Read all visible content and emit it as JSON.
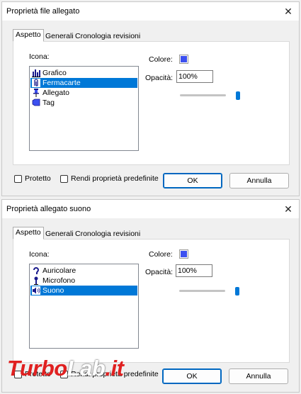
{
  "dialog1": {
    "title": "Proprietà file allegato",
    "close_glyph": "✕",
    "tabs": [
      "Aspetto",
      "Generali",
      "Cronologia revisioni"
    ],
    "icon_label": "Icona:",
    "items": [
      {
        "label": "Grafico",
        "icon": "bar-chart-icon",
        "selected": false
      },
      {
        "label": "Fermacarte",
        "icon": "paperclip-icon",
        "selected": true
      },
      {
        "label": "Allegato",
        "icon": "pushpin-icon",
        "selected": false
      },
      {
        "label": "Tag",
        "icon": "tag-icon",
        "selected": false
      }
    ],
    "color_label": "Colore:",
    "color_value": "#3c50f0",
    "opacity_label": "Opacità:",
    "opacity_value": "100%",
    "opacity_fraction": 1.0,
    "locked_label": "Protetto",
    "default_label": "Rendi proprietà predefinite",
    "ok_label": "OK",
    "cancel_label": "Annulla"
  },
  "dialog2": {
    "title": "Proprietà allegato suono",
    "close_glyph": "✕",
    "tabs": [
      "Aspetto",
      "Generali",
      "Cronologia revisioni"
    ],
    "icon_label": "Icona:",
    "items": [
      {
        "label": "Auricolare",
        "icon": "earphone-icon",
        "selected": false
      },
      {
        "label": "Microfono",
        "icon": "microphone-icon",
        "selected": false
      },
      {
        "label": "Suono",
        "icon": "speaker-icon",
        "selected": true
      }
    ],
    "color_label": "Colore:",
    "color_value": "#3c50f0",
    "opacity_label": "Opacità:",
    "opacity_value": "100%",
    "opacity_fraction": 1.0,
    "locked_label": "Protetto",
    "default_label": "Rendi proprietà predefinite",
    "ok_label": "OK",
    "cancel_label": "Annulla"
  },
  "watermark": {
    "part1": "Turbo",
    "part2": "Lab",
    "part3": ".it",
    "color1": "#e02020",
    "color2": "#ffffff"
  }
}
